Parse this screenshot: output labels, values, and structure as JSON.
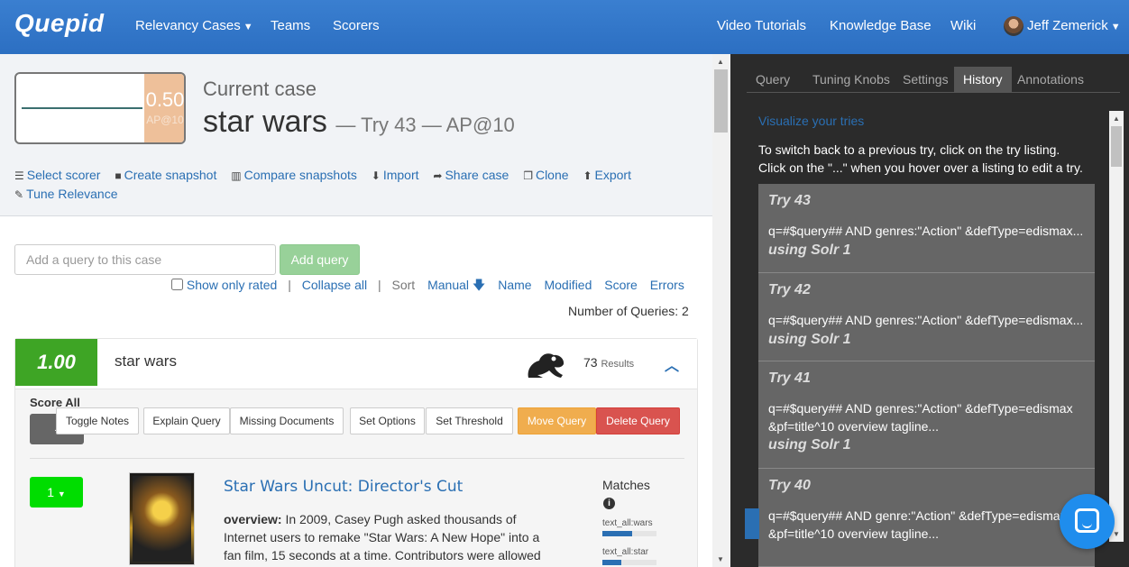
{
  "navbar": {
    "brand": "Quepid",
    "relevancy_cases": "Relevancy Cases",
    "teams": "Teams",
    "scorers": "Scorers",
    "video_tutorials": "Video Tutorials",
    "knowledge_base": "Knowledge Base",
    "wiki": "Wiki",
    "user": "Jeff Zemerick"
  },
  "case": {
    "score": "0.50",
    "metric": "AP@10",
    "label": "Current case",
    "title": "star wars",
    "subtitle": "— Try 43 — AP@10"
  },
  "toolbar": {
    "select_scorer": "Select scorer",
    "create_snapshot": "Create snapshot",
    "compare_snapshots": "Compare snapshots",
    "import": "Import",
    "share_case": "Share case",
    "clone": "Clone",
    "export": "Export",
    "tune_relevance": "Tune Relevance"
  },
  "query_add": {
    "placeholder": "Add a query to this case",
    "button": "Add query"
  },
  "sort": {
    "show_only_rated": "Show only rated",
    "collapse_all": "Collapse all",
    "sort_label": "Sort",
    "manual": "Manual",
    "name": "Name",
    "modified": "Modified",
    "score": "Score",
    "errors": "Errors"
  },
  "number_of_queries": "Number of Queries: 2",
  "query": {
    "score": "1.00",
    "text": "star wars",
    "results_count": "73",
    "results_label": "Results",
    "score_all": "Score All",
    "score_all_button": "-",
    "buttons": {
      "toggle_notes": "Toggle Notes",
      "explain_query": "Explain Query",
      "missing_documents": "Missing Documents",
      "set_options": "Set Options",
      "set_threshold": "Set Threshold",
      "move_query": "Move Query",
      "delete_query": "Delete Query"
    }
  },
  "doc": {
    "rating": "1",
    "title": "Star Wars Uncut: Director's Cut",
    "overview_label": "overview:",
    "overview": "In 2009, Casey Pugh asked thousands of Internet users to remake \"Star Wars: A New Hope\" into a fan film, 15 seconds at a time. Contributors were allowed",
    "matches_label": "Matches",
    "fields": [
      {
        "name": "text_all:wars",
        "fraction": 0.55
      },
      {
        "name": "text_all:star",
        "fraction": 0.35
      }
    ]
  },
  "right_panel": {
    "tabs": [
      "Query",
      "Tuning Knobs",
      "Settings",
      "History",
      "Annotations"
    ],
    "active_tab": "History",
    "visualize": "Visualize your tries",
    "help_line1": "To switch back to a previous try, click on the try listing.",
    "help_line2": "Click on the \"...\" when you hover over a listing to edit a try.",
    "tries": [
      {
        "name": "Try 43",
        "query": "q=#$query## AND genres:\"Action\" &defType=edismax...",
        "engine": "using Solr 1"
      },
      {
        "name": "Try 42",
        "query": "q=#$query## AND genres:\"Action\" &defType=edismax...",
        "engine": "using Solr 1"
      },
      {
        "name": "Try 41",
        "query": "q=#$query## AND genres:\"Action\" &defType=edismax &pf=title^10 overview tagline...",
        "engine": "using Solr 1"
      },
      {
        "name": "Try 40",
        "query": "q=#$query## AND genre:\"Action\" &defType=edismax &pf=title^10 overview tagline...",
        "engine": ""
      }
    ]
  },
  "colors": {
    "navbar": "#2c6fc2",
    "link": "#2a6fb3",
    "query_score": "#3ea525",
    "rating": "#00dd00",
    "case_score": "#eec09a"
  }
}
